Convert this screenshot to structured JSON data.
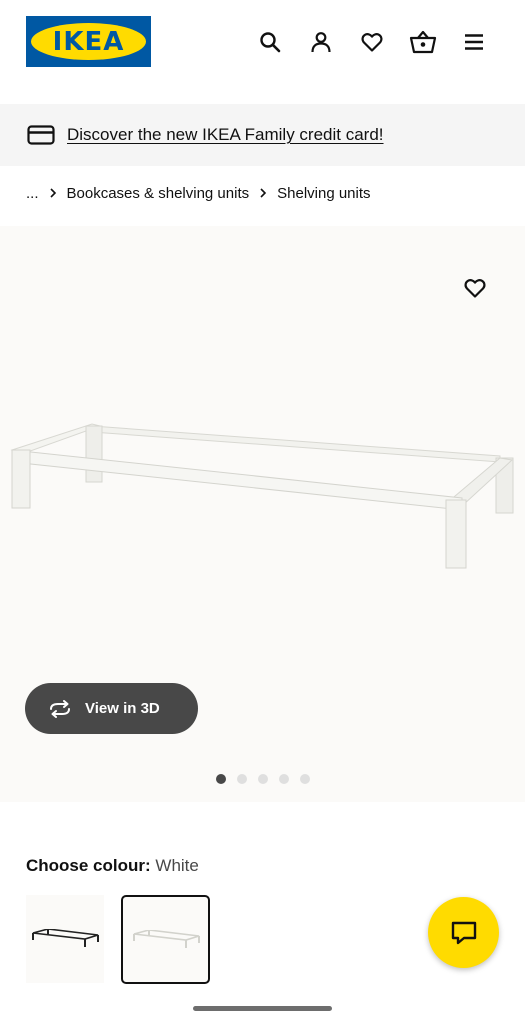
{
  "header": {
    "logo_text": "IKEA",
    "icons": [
      "search-icon",
      "account-icon",
      "favourites-icon",
      "shopping-bag-icon",
      "menu-icon"
    ]
  },
  "banner": {
    "icon": "credit-card-icon",
    "link_text": "Discover the new IKEA Family credit card!"
  },
  "breadcrumb": {
    "ellipsis": "...",
    "items": [
      "Bookcases & shelving units",
      "Shelving units"
    ]
  },
  "gallery": {
    "view_3d_label": "View in 3D",
    "image_count": 5,
    "active_index": 0
  },
  "colour": {
    "label": "Choose colour:",
    "value": "White",
    "options": [
      "black",
      "white"
    ],
    "selected": "white"
  },
  "colors": {
    "brand_blue": "#0058a3",
    "brand_yellow": "#ffdb00",
    "dark_button": "#484848"
  }
}
